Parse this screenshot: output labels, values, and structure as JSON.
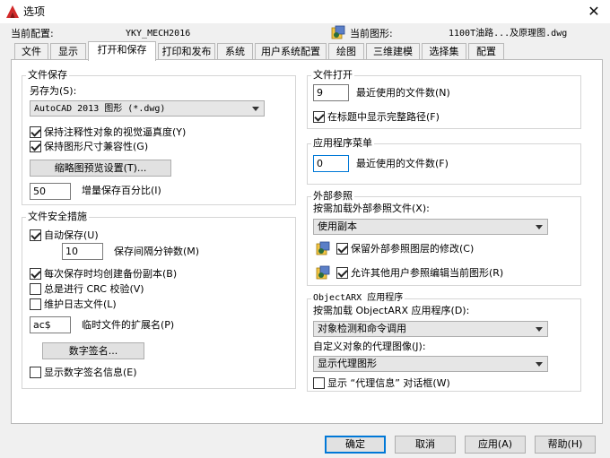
{
  "window": {
    "title": "选项",
    "close_glyph": "✕"
  },
  "profile": {
    "current_profile_label": "当前配置:",
    "current_profile_value": "YKY_MECH2016",
    "current_drawing_label": "当前图形:",
    "current_drawing_value": "1100T油路...及原理图.dwg"
  },
  "tabs": [
    {
      "label": "文件",
      "active": false
    },
    {
      "label": "显示",
      "active": false
    },
    {
      "label": "打开和保存",
      "active": true
    },
    {
      "label": "打印和发布",
      "active": false
    },
    {
      "label": "系统",
      "active": false
    },
    {
      "label": "用户系统配置",
      "active": false
    },
    {
      "label": "绘图",
      "active": false
    },
    {
      "label": "三维建模",
      "active": false
    },
    {
      "label": "选择集",
      "active": false
    },
    {
      "label": "配置",
      "active": false
    }
  ],
  "file_save": {
    "title": "文件保存",
    "save_as_label": "另存为(S):",
    "save_as_value": "AutoCAD 2013 图形 (*.dwg)",
    "maintain_visual_fidelity": {
      "label": "保持注释性对象的视觉逼真度(Y)",
      "checked": true
    },
    "maintain_drawing_size": {
      "label": "保持图形尺寸兼容性(G)",
      "checked": true
    },
    "thumbnail_button": "缩略图预览设置(T)...",
    "incremental_value": "50",
    "incremental_label": "增量保存百分比(I)"
  },
  "file_safety": {
    "title": "文件安全措施",
    "autosave": {
      "label": "自动保存(U)",
      "checked": true
    },
    "minutes_value": "10",
    "minutes_label": "保存间隔分钟数(M)",
    "backup_copy": {
      "label": "每次保存时均创建备份副本(B)",
      "checked": true
    },
    "crc_check": {
      "label": "总是进行 CRC 校验(V)",
      "checked": false
    },
    "log_file": {
      "label": "维护日志文件(L)",
      "checked": false
    },
    "temp_ext_value": "ac$",
    "temp_ext_label": "临时文件的扩展名(P)",
    "digital_signature_button": "数字签名...",
    "display_signature": {
      "label": "显示数字签名信息(E)",
      "checked": false
    }
  },
  "file_open": {
    "title": "文件打开",
    "recent_files_value": "9",
    "recent_files_label": "最近使用的文件数(N)",
    "full_path": {
      "label": "在标题中显示完整路径(F)",
      "checked": true
    }
  },
  "app_menu": {
    "title": "应用程序菜单",
    "recent_files_value": "0",
    "recent_files_label": "最近使用的文件数(F)"
  },
  "xrefs": {
    "title": "外部参照",
    "demand_load_label": "按需加载外部参照文件(X):",
    "demand_load_value": "使用副本",
    "retain_changes": {
      "label": "保留外部参照图层的修改(C)",
      "checked": true
    },
    "allow_edit": {
      "label": "允许其他用户参照编辑当前图形(R)",
      "checked": true
    }
  },
  "objectarx": {
    "title": "ObjectARX 应用程序",
    "demand_load_label": "按需加载 ObjectARX 应用程序(D):",
    "demand_load_value": "对象检测和命令调用",
    "proxy_images_label": "自定义对象的代理图像(J):",
    "proxy_images_value": "显示代理图形",
    "proxy_info": {
      "label": "显示 “代理信息” 对话框(W)",
      "checked": false
    }
  },
  "buttons": {
    "ok": "确定",
    "cancel": "取消",
    "apply": "应用(A)",
    "help": "帮助(H)"
  },
  "colors": {
    "accent": "#0078d7",
    "app_icon": "#d22a2a",
    "panel_bg": "#ffffff",
    "dialog_bg": "#f0f0f0"
  }
}
